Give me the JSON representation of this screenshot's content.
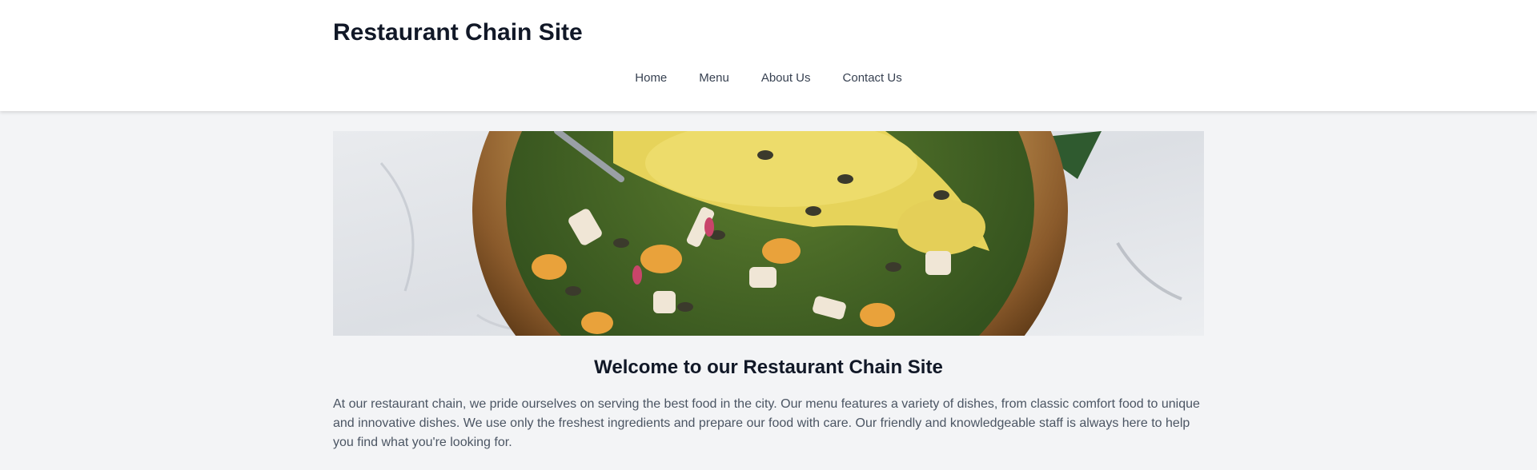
{
  "header": {
    "site_title": "Restaurant Chain Site",
    "nav": [
      {
        "label": "Home"
      },
      {
        "label": "Menu"
      },
      {
        "label": "About Us"
      },
      {
        "label": "Contact Us"
      }
    ]
  },
  "hero": {
    "image_icon": "salad-bowl-photo"
  },
  "main": {
    "heading": "Welcome to our Restaurant Chain Site",
    "intro": "At our restaurant chain, we pride ourselves on serving the best food in the city. Our menu features a variety of dishes, from classic comfort food to unique and innovative dishes. We use only the freshest ingredients and prepare our food with care. Our friendly and knowledgeable staff is always here to help you find what you're looking for."
  },
  "colors": {
    "page_bg": "#f3f4f6",
    "header_bg": "#ffffff",
    "title_text": "#111827",
    "body_text": "#4b5563"
  }
}
